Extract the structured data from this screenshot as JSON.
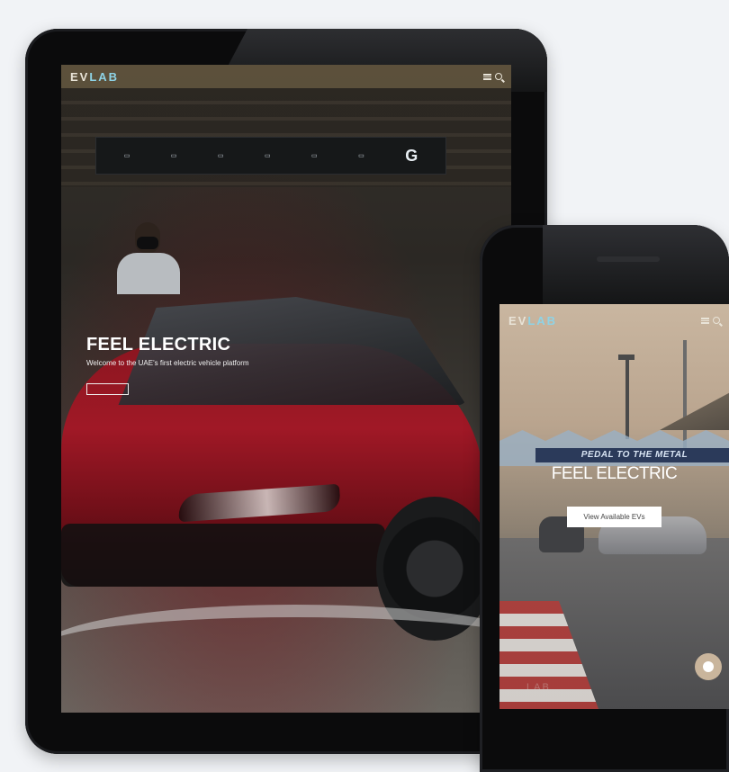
{
  "tablet": {
    "logo": {
      "part1": "EV",
      "part2": "LAB"
    },
    "sign_letter": "G",
    "hero": {
      "title": "FEEL ELECTRIC",
      "subtitle": "Welcome to the UAE's first electric vehicle platform"
    }
  },
  "phone": {
    "logo": {
      "part1": "EV",
      "part2": "LAB"
    },
    "banner": "PEDAL TO THE METAL",
    "hero": {
      "title": "FEEL ELECTRIC",
      "button_label": "View Available EVs"
    },
    "watermark": "LAB"
  },
  "colors": {
    "logo_accent": "#8ed3e6",
    "car_red": "#a01826"
  },
  "icons": [
    "menu-icon",
    "search-icon",
    "chat-icon"
  ]
}
